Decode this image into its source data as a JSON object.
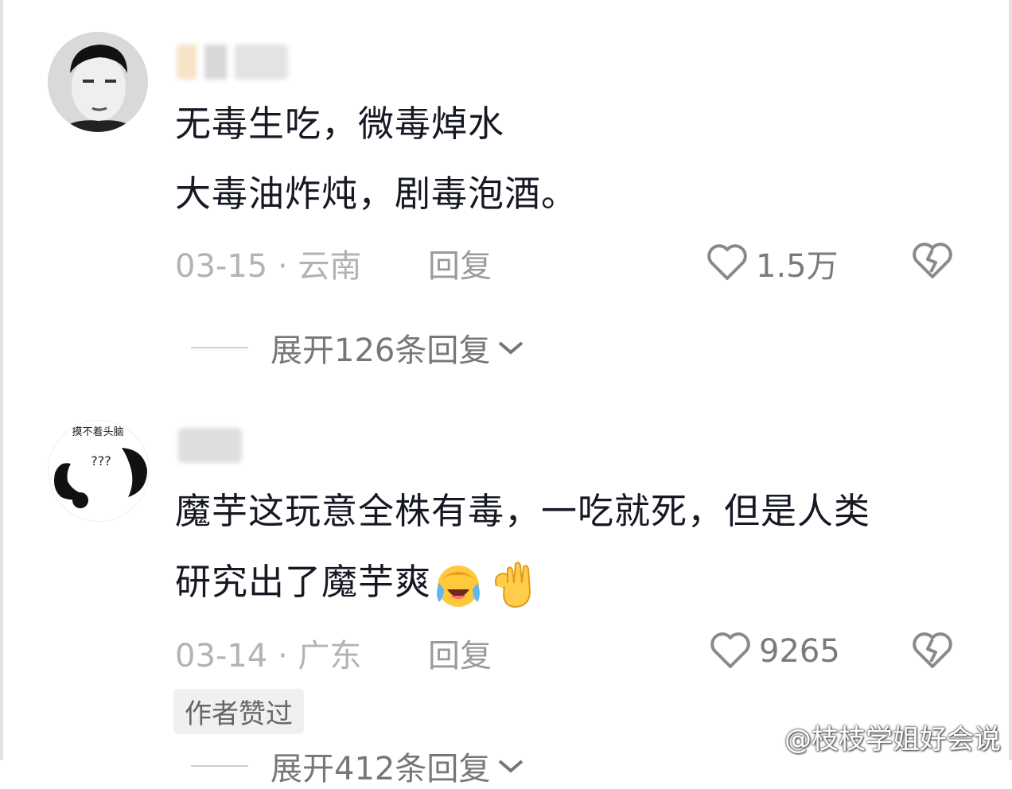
{
  "comments": [
    {
      "avatar": "user-portrait-avatar",
      "text_lines": [
        "无毒生吃，微毒焯水",
        "大毒油炸炖，剧毒泡酒。"
      ],
      "date": "03-15",
      "location": "云南",
      "meta": "03-15 · 云南",
      "reply_label": "回复",
      "likes": "1.5万",
      "expand_label": "展开126条回复"
    },
    {
      "avatar": "question-marks-avatar",
      "avatar_text": [
        "摸不着头脑",
        "???"
      ],
      "text_lines": [
        "魔芋这玩意全株有毒，一吃就死，但是人类",
        "研究出了魔芋爽"
      ],
      "emojis": [
        "laughing-crying-emoji",
        "ok-hand-emoji"
      ],
      "date": "03-14",
      "location": "广东",
      "meta": "03-14 · 广东",
      "reply_label": "回复",
      "likes": "9265",
      "author_badge": "作者赞过",
      "expand_label": "展开412条回复"
    }
  ],
  "watermark": "@枝枝学姐好会说",
  "icons": {
    "like": "heart-outline-icon",
    "dislike": "broken-heart-icon",
    "expand": "chevron-down-icon",
    "watermark": "weibo-logo-icon"
  },
  "colors": {
    "text": "#161823",
    "meta": "#b3b3b3",
    "badge_bg": "#f0f0f0"
  }
}
